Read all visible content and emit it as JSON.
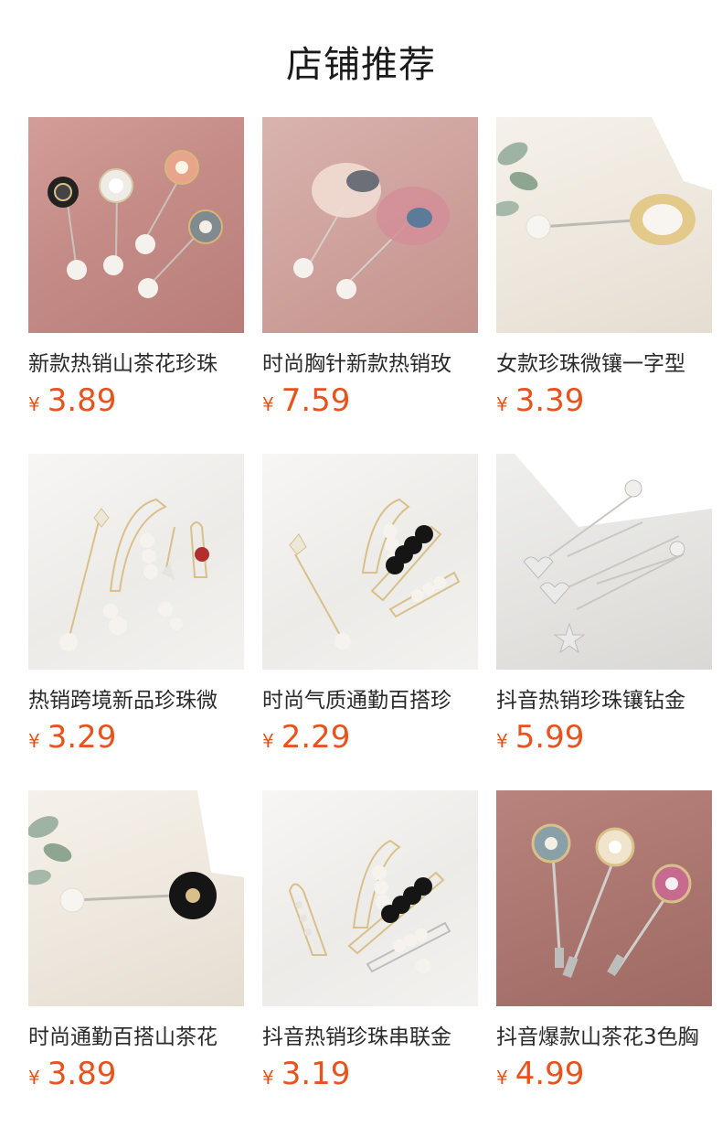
{
  "section_title": "店铺推荐",
  "currency_symbol": "¥",
  "products": [
    {
      "title": "新款热销山茶花珍珠",
      "price": "3.89",
      "image": "camellia-pearl-pins"
    },
    {
      "title": "时尚胸针新款热销玫",
      "price": "7.59",
      "image": "chiffon-flower-pearl-pins"
    },
    {
      "title": "女款珍珠微镶一字型",
      "price": "3.39",
      "image": "oval-pearl-stick-pin"
    },
    {
      "title": "热销跨境新品珍珠微",
      "price": "3.29",
      "image": "pearl-safety-pins-set"
    },
    {
      "title": "时尚气质通勤百搭珍",
      "price": "2.29",
      "image": "black-pearl-safety-pins"
    },
    {
      "title": "抖音热销珍珠镶钻金",
      "price": "5.99",
      "image": "silver-rhinestone-stick-pins"
    },
    {
      "title": "时尚通勤百搭山茶花",
      "price": "3.89",
      "image": "black-camellia-stick-pin"
    },
    {
      "title": "抖音热销珍珠串联金",
      "price": "3.19",
      "image": "chain-pearl-safety-pins"
    },
    {
      "title": "抖音爆款山茶花3色胸",
      "price": "4.99",
      "image": "three-color-camellia-pins"
    }
  ]
}
